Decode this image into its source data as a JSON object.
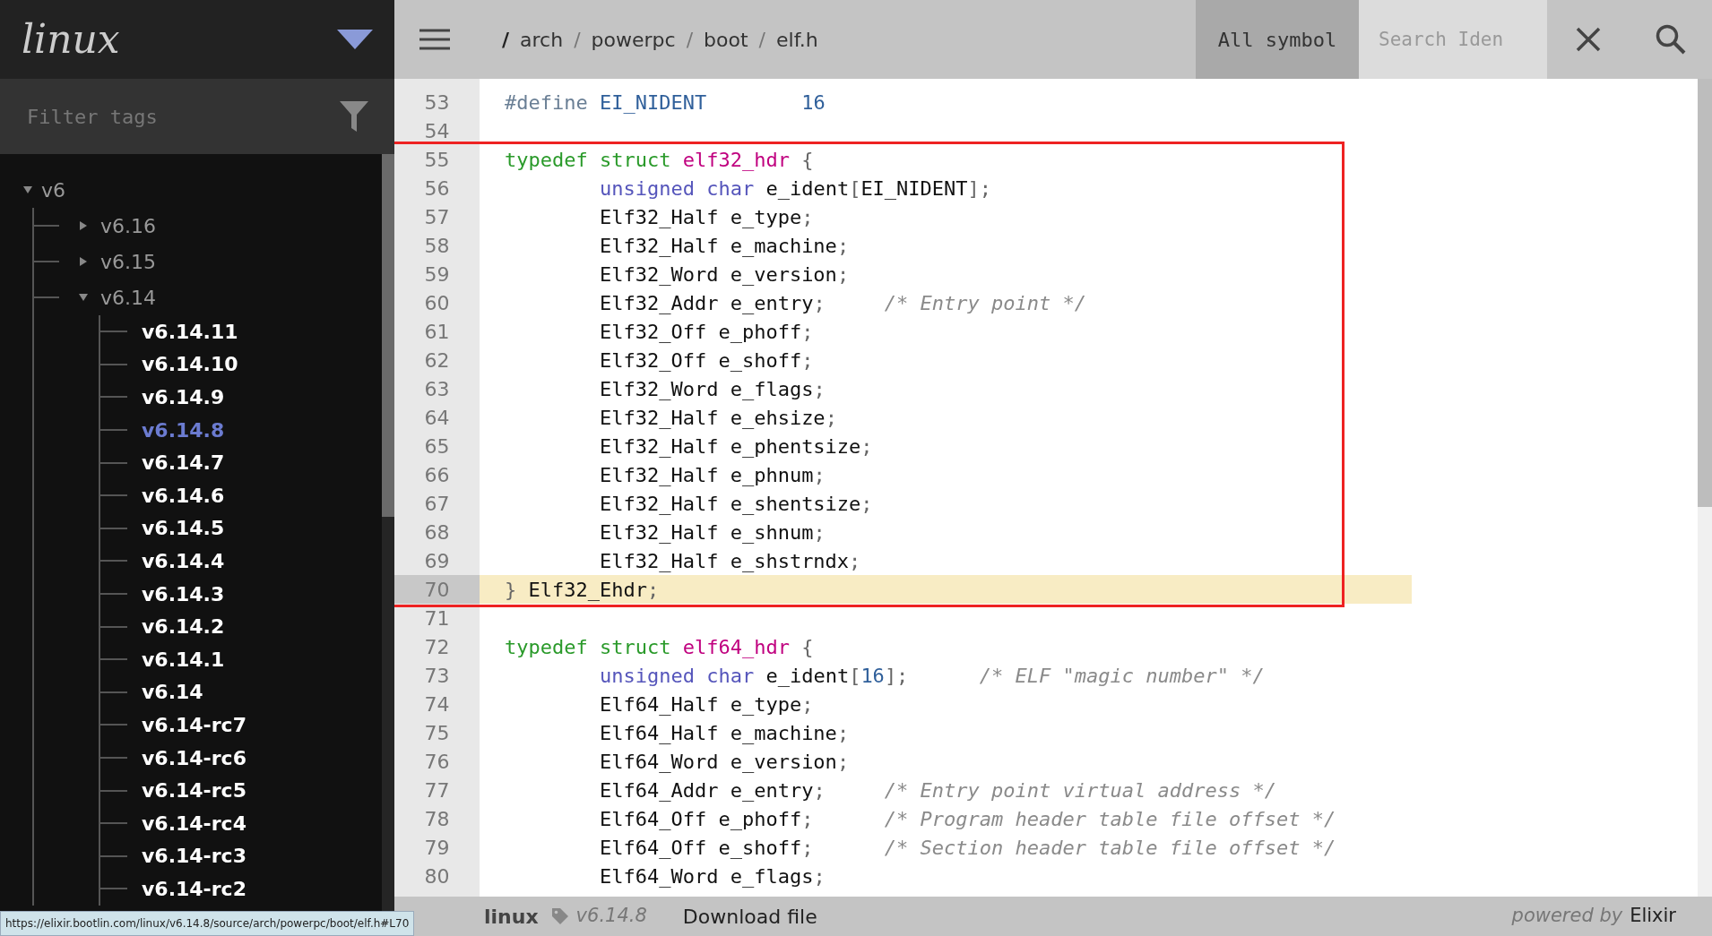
{
  "sidebar": {
    "project": "linux",
    "filter": {
      "placeholder": "Filter tags"
    },
    "tree": [
      {
        "label": "v6",
        "expanded": true,
        "children": [
          {
            "label": "v6.16",
            "expanded": false
          },
          {
            "label": "v6.15",
            "expanded": false
          },
          {
            "label": "v6.14",
            "expanded": true,
            "children": [
              {
                "label": "v6.14.11",
                "selected": false
              },
              {
                "label": "v6.14.10",
                "selected": false
              },
              {
                "label": "v6.14.9",
                "selected": false
              },
              {
                "label": "v6.14.8",
                "selected": true
              },
              {
                "label": "v6.14.7",
                "selected": false
              },
              {
                "label": "v6.14.6",
                "selected": false
              },
              {
                "label": "v6.14.5",
                "selected": false
              },
              {
                "label": "v6.14.4",
                "selected": false
              },
              {
                "label": "v6.14.3",
                "selected": false
              },
              {
                "label": "v6.14.2",
                "selected": false
              },
              {
                "label": "v6.14.1",
                "selected": false
              },
              {
                "label": "v6.14",
                "selected": false
              },
              {
                "label": "v6.14-rc7",
                "selected": false
              },
              {
                "label": "v6.14-rc6",
                "selected": false
              },
              {
                "label": "v6.14-rc5",
                "selected": false
              },
              {
                "label": "v6.14-rc4",
                "selected": false
              },
              {
                "label": "v6.14-rc3",
                "selected": false
              },
              {
                "label": "v6.14-rc2",
                "selected": false
              }
            ]
          }
        ]
      }
    ]
  },
  "topbar": {
    "breadcrumb": [
      "/",
      "arch",
      "/",
      "powerpc",
      "/",
      "boot",
      "/",
      "elf.h"
    ],
    "symbol_filter": "All symbol",
    "search": {
      "placeholder": "Search Iden"
    }
  },
  "code": {
    "lines": [
      {
        "number": "53",
        "highlighted": false,
        "boxed": false,
        "tokens": [
          {
            "kind": "pp",
            "text": "#define "
          },
          {
            "kind": "m",
            "text": "EI_NIDENT"
          },
          {
            "kind": "n",
            "text": "        16"
          }
        ]
      },
      {
        "number": "54",
        "highlighted": false,
        "boxed": false
      },
      {
        "number": "55",
        "highlighted": false,
        "boxed": true,
        "tokens": [
          {
            "kind": "kw",
            "text": "typedef struct "
          },
          {
            "kind": "def",
            "text": "elf32_hdr"
          },
          {
            "kind": "p",
            "text": " {"
          }
        ]
      },
      {
        "number": "56",
        "highlighted": false,
        "boxed": true,
        "tokens": [
          {
            "kind": "type",
            "text": "        unsigned char "
          },
          {
            "kind": "id",
            "text": "e_ident"
          },
          {
            "kind": "p",
            "text": "["
          },
          {
            "kind": "id",
            "text": "EI_NIDENT"
          },
          {
            "kind": "p",
            "text": "];"
          }
        ]
      },
      {
        "number": "57",
        "highlighted": false,
        "boxed": true,
        "tokens": [
          {
            "kind": "id",
            "text": "        Elf32_Half e_type"
          },
          {
            "kind": "p",
            "text": ";"
          }
        ]
      },
      {
        "number": "58",
        "highlighted": false,
        "boxed": true,
        "tokens": [
          {
            "kind": "id",
            "text": "        Elf32_Half e_machine"
          },
          {
            "kind": "p",
            "text": ";"
          }
        ]
      },
      {
        "number": "59",
        "highlighted": false,
        "boxed": true,
        "tokens": [
          {
            "kind": "id",
            "text": "        Elf32_Word e_version"
          },
          {
            "kind": "p",
            "text": ";"
          }
        ]
      },
      {
        "number": "60",
        "highlighted": false,
        "boxed": true,
        "tokens": [
          {
            "kind": "id",
            "text": "        Elf32_Addr e_entry"
          },
          {
            "kind": "p",
            "text": ";"
          },
          {
            "kind": "c",
            "text": "     /* Entry point */"
          }
        ]
      },
      {
        "number": "61",
        "highlighted": false,
        "boxed": true,
        "tokens": [
          {
            "kind": "id",
            "text": "        Elf32_Off e_phoff"
          },
          {
            "kind": "p",
            "text": ";"
          }
        ]
      },
      {
        "number": "62",
        "highlighted": false,
        "boxed": true,
        "tokens": [
          {
            "kind": "id",
            "text": "        Elf32_Off e_shoff"
          },
          {
            "kind": "p",
            "text": ";"
          }
        ]
      },
      {
        "number": "63",
        "highlighted": false,
        "boxed": true,
        "tokens": [
          {
            "kind": "id",
            "text": "        Elf32_Word e_flags"
          },
          {
            "kind": "p",
            "text": ";"
          }
        ]
      },
      {
        "number": "64",
        "highlighted": false,
        "boxed": true,
        "tokens": [
          {
            "kind": "id",
            "text": "        Elf32_Half e_ehsize"
          },
          {
            "kind": "p",
            "text": ";"
          }
        ]
      },
      {
        "number": "65",
        "highlighted": false,
        "boxed": true,
        "tokens": [
          {
            "kind": "id",
            "text": "        Elf32_Half e_phentsize"
          },
          {
            "kind": "p",
            "text": ";"
          }
        ]
      },
      {
        "number": "66",
        "highlighted": false,
        "boxed": true,
        "tokens": [
          {
            "kind": "id",
            "text": "        Elf32_Half e_phnum"
          },
          {
            "kind": "p",
            "text": ";"
          }
        ]
      },
      {
        "number": "67",
        "highlighted": false,
        "boxed": true,
        "tokens": [
          {
            "kind": "id",
            "text": "        Elf32_Half e_shentsize"
          },
          {
            "kind": "p",
            "text": ";"
          }
        ]
      },
      {
        "number": "68",
        "highlighted": false,
        "boxed": true,
        "tokens": [
          {
            "kind": "id",
            "text": "        Elf32_Half e_shnum"
          },
          {
            "kind": "p",
            "text": ";"
          }
        ]
      },
      {
        "number": "69",
        "highlighted": false,
        "boxed": true,
        "tokens": [
          {
            "kind": "id",
            "text": "        Elf32_Half e_shstrndx"
          },
          {
            "kind": "p",
            "text": ";"
          }
        ]
      },
      {
        "number": "70",
        "highlighted": true,
        "boxed": true,
        "tokens": [
          {
            "kind": "p",
            "text": "} "
          },
          {
            "kind": "id",
            "text": "Elf32_Ehdr"
          },
          {
            "kind": "p",
            "text": ";"
          }
        ]
      },
      {
        "number": "71",
        "highlighted": false,
        "boxed": false
      },
      {
        "number": "72",
        "highlighted": false,
        "boxed": false,
        "tokens": [
          {
            "kind": "kw",
            "text": "typedef struct "
          },
          {
            "kind": "def",
            "text": "elf64_hdr"
          },
          {
            "kind": "p",
            "text": " {"
          }
        ]
      },
      {
        "number": "73",
        "highlighted": false,
        "boxed": false,
        "tokens": [
          {
            "kind": "type",
            "text": "        unsigned char "
          },
          {
            "kind": "id",
            "text": "e_ident"
          },
          {
            "kind": "p",
            "text": "["
          },
          {
            "kind": "n",
            "text": "16"
          },
          {
            "kind": "p",
            "text": "];"
          },
          {
            "kind": "c",
            "text": "      /* ELF \"magic number\" */"
          }
        ]
      },
      {
        "number": "74",
        "highlighted": false,
        "boxed": false,
        "tokens": [
          {
            "kind": "id",
            "text": "        Elf64_Half e_type"
          },
          {
            "kind": "p",
            "text": ";"
          }
        ]
      },
      {
        "number": "75",
        "highlighted": false,
        "boxed": false,
        "tokens": [
          {
            "kind": "id",
            "text": "        Elf64_Half e_machine"
          },
          {
            "kind": "p",
            "text": ";"
          }
        ]
      },
      {
        "number": "76",
        "highlighted": false,
        "boxed": false,
        "tokens": [
          {
            "kind": "id",
            "text": "        Elf64_Word e_version"
          },
          {
            "kind": "p",
            "text": ";"
          }
        ]
      },
      {
        "number": "77",
        "highlighted": false,
        "boxed": false,
        "tokens": [
          {
            "kind": "id",
            "text": "        Elf64_Addr e_entry"
          },
          {
            "kind": "p",
            "text": ";"
          },
          {
            "kind": "c",
            "text": "     /* Entry point virtual address */"
          }
        ]
      },
      {
        "number": "78",
        "highlighted": false,
        "boxed": false,
        "tokens": [
          {
            "kind": "id",
            "text": "        Elf64_Off e_phoff"
          },
          {
            "kind": "p",
            "text": ";"
          },
          {
            "kind": "c",
            "text": "      /* Program header table file offset */"
          }
        ]
      },
      {
        "number": "79",
        "highlighted": false,
        "boxed": false,
        "tokens": [
          {
            "kind": "id",
            "text": "        Elf64_Off e_shoff"
          },
          {
            "kind": "p",
            "text": ";"
          },
          {
            "kind": "c",
            "text": "      /* Section header table file offset */"
          }
        ]
      },
      {
        "number": "80",
        "highlighted": false,
        "boxed": false,
        "tokens": [
          {
            "kind": "id",
            "text": "        Elf64_Word e_flags"
          },
          {
            "kind": "p",
            "text": ";"
          }
        ]
      }
    ]
  },
  "footer": {
    "project": "linux",
    "version": "v6.14.8",
    "download": "Download file",
    "powered_by": "powered by",
    "engine": "Elixir"
  },
  "status_url": "https://elixir.bootlin.com/linux/v6.14.8/source/arch/powerpc/boot/elf.h#L70"
}
